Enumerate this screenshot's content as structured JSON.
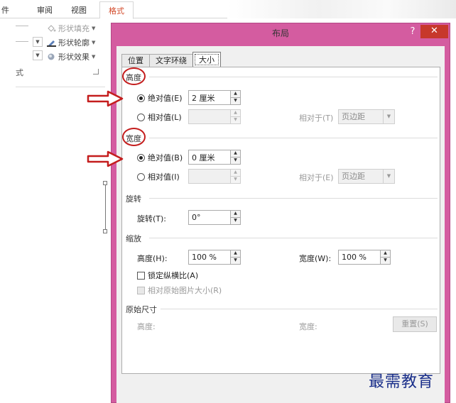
{
  "ribbon": {
    "tabs": [
      "审阅",
      "视图",
      "格式"
    ],
    "tab_fragment": "件",
    "shape_fill": "形状填充",
    "shape_outline": "形状轮廓",
    "shape_effect": "形状效果",
    "group_label": "式"
  },
  "dialog": {
    "title": "布局",
    "help": "?",
    "close": "✕",
    "tabs": [
      "位置",
      "文字环绕",
      "大小"
    ],
    "active_tab": "大小",
    "height_section": "高度",
    "height_absolute_label": "绝对值(E)",
    "height_absolute_value": "2 厘米",
    "height_relative_label": "相对值(L)",
    "height_relative_to_label": "相对于(T)",
    "height_relative_to_value": "页边距",
    "width_section": "宽度",
    "width_absolute_label": "绝对值(B)",
    "width_absolute_value": "0 厘米",
    "width_relative_label": "相对值(I)",
    "width_relative_to_label": "相对于(E)",
    "width_relative_to_value": "页边距",
    "rotate_section": "旋转",
    "rotate_label": "旋转(T):",
    "rotate_value": "0°",
    "scale_section": "缩放",
    "scale_height_label": "高度(H):",
    "scale_height_value": "100 %",
    "scale_width_label": "宽度(W):",
    "scale_width_value": "100 %",
    "lock_aspect_label": "锁定纵横比(A)",
    "relative_original_label": "相对原始图片大小(R)",
    "original_size_section": "原始尺寸",
    "original_height_label": "高度:",
    "original_width_label": "宽度:",
    "reset_label": "重置(S)"
  },
  "watermark": "最需教育",
  "colors": {
    "dialog_frame": "#d45ca0",
    "close_button": "#c7382b",
    "annotation": "#c41d1d",
    "watermark": "#1a2f8a",
    "active_ribbon_tab": "#d24726"
  }
}
